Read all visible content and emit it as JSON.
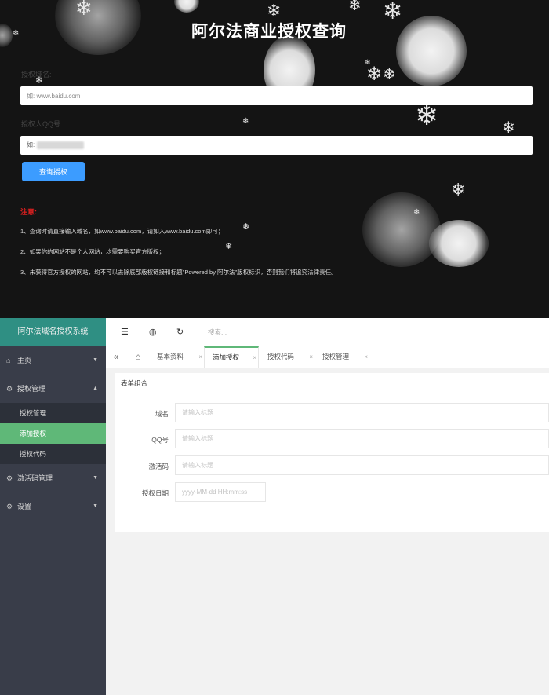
{
  "query_page": {
    "title": "阿尔法商业授权查询",
    "domain_label": "授权域名:",
    "domain_placeholder": "如: www.baidu.com",
    "qq_label": "授权人QQ号:",
    "qq_prefix": "如:",
    "query_button": "查询授权",
    "notice_title": "注意:",
    "notices": [
      "1、查询时请直接输入域名，如www.baidu.com，请如入www.baidu.com即可；",
      "2、如果你的网站不是个人网站，均需要购买官方版权；",
      "3、未获得官方授权的网站，均不可以去除底部版权链接和标题\"Powered by 阿尔法\"版权标识，否则我们将追究法律责任。"
    ]
  },
  "admin": {
    "brand": "阿尔法域名授权系统",
    "sidebar": {
      "home": "主页",
      "auth_manage": "授权管理",
      "sub_items": [
        "授权管理",
        "添加授权",
        "授权代码"
      ],
      "activation_manage": "激活码管理",
      "settings": "设置"
    },
    "topbar": {
      "search_placeholder": "搜索..."
    },
    "tabs": [
      {
        "label": "基本资料",
        "active": false
      },
      {
        "label": "添加授权",
        "active": true
      },
      {
        "label": "授权代码",
        "active": false
      },
      {
        "label": "授权管理",
        "active": false
      }
    ],
    "form": {
      "title": "表单组合",
      "fields": [
        {
          "label": "域名",
          "placeholder": "请输入标题"
        },
        {
          "label": "QQ号",
          "placeholder": "请输入标题"
        },
        {
          "label": "激活码",
          "placeholder": "请输入标题"
        },
        {
          "label": "授权日期",
          "placeholder": "yyyy-MM-dd HH:mm:ss"
        }
      ]
    }
  },
  "colors": {
    "query_bg": "#141414",
    "query_button": "#3c9cff",
    "notice_red": "#e02020",
    "brand_bg": "#2f8f83",
    "sidebar_bg": "#393d49",
    "active_green": "#5fb878"
  }
}
